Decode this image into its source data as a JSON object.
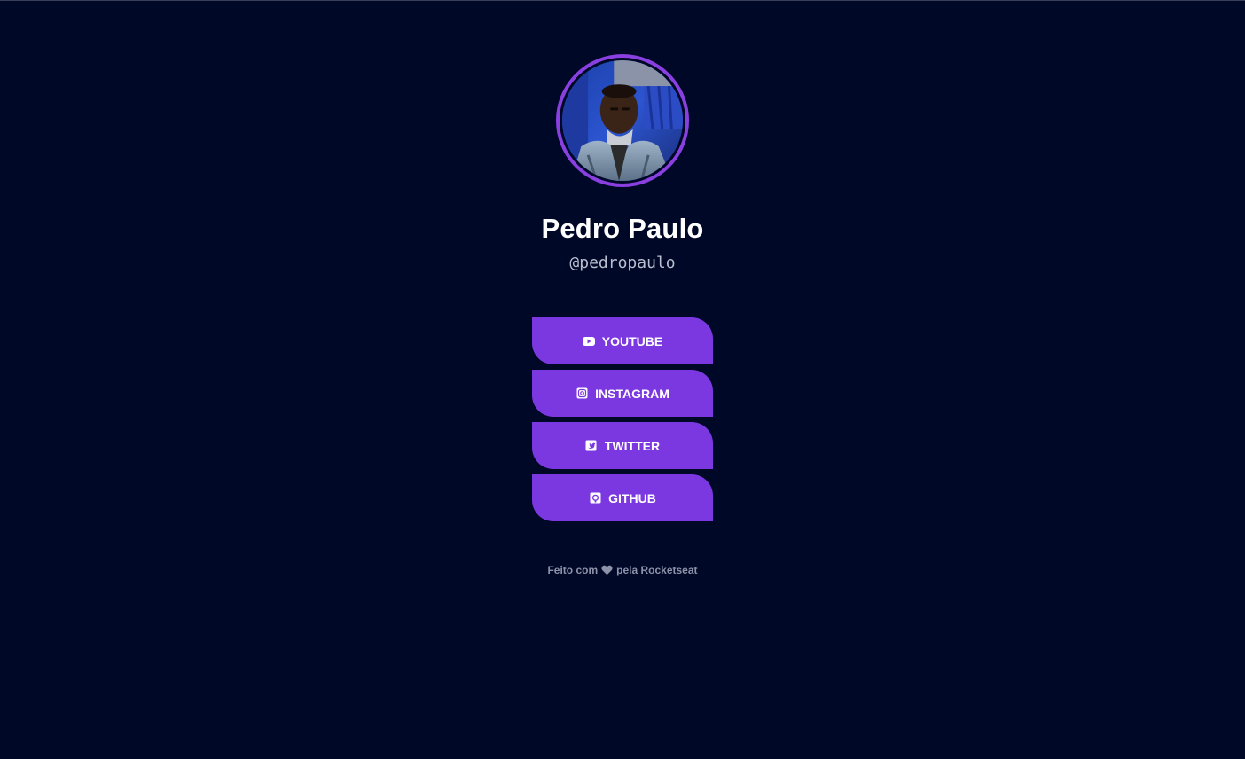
{
  "profile": {
    "name": "Pedro Paulo",
    "handle": "@pedropaulo"
  },
  "links": [
    {
      "label": "YOUTUBE",
      "icon": "youtube-icon"
    },
    {
      "label": "INSTAGRAM",
      "icon": "instagram-icon"
    },
    {
      "label": "TWITTER",
      "icon": "twitter-icon"
    },
    {
      "label": "GITHUB",
      "icon": "github-icon"
    }
  ],
  "footer": {
    "before": "Feito com",
    "icon": "heart-icon",
    "after": "pela Rocketseat"
  },
  "colors": {
    "background": "#000828",
    "accent": "#7b37e0",
    "avatar_ring": "#8a3fe0"
  }
}
